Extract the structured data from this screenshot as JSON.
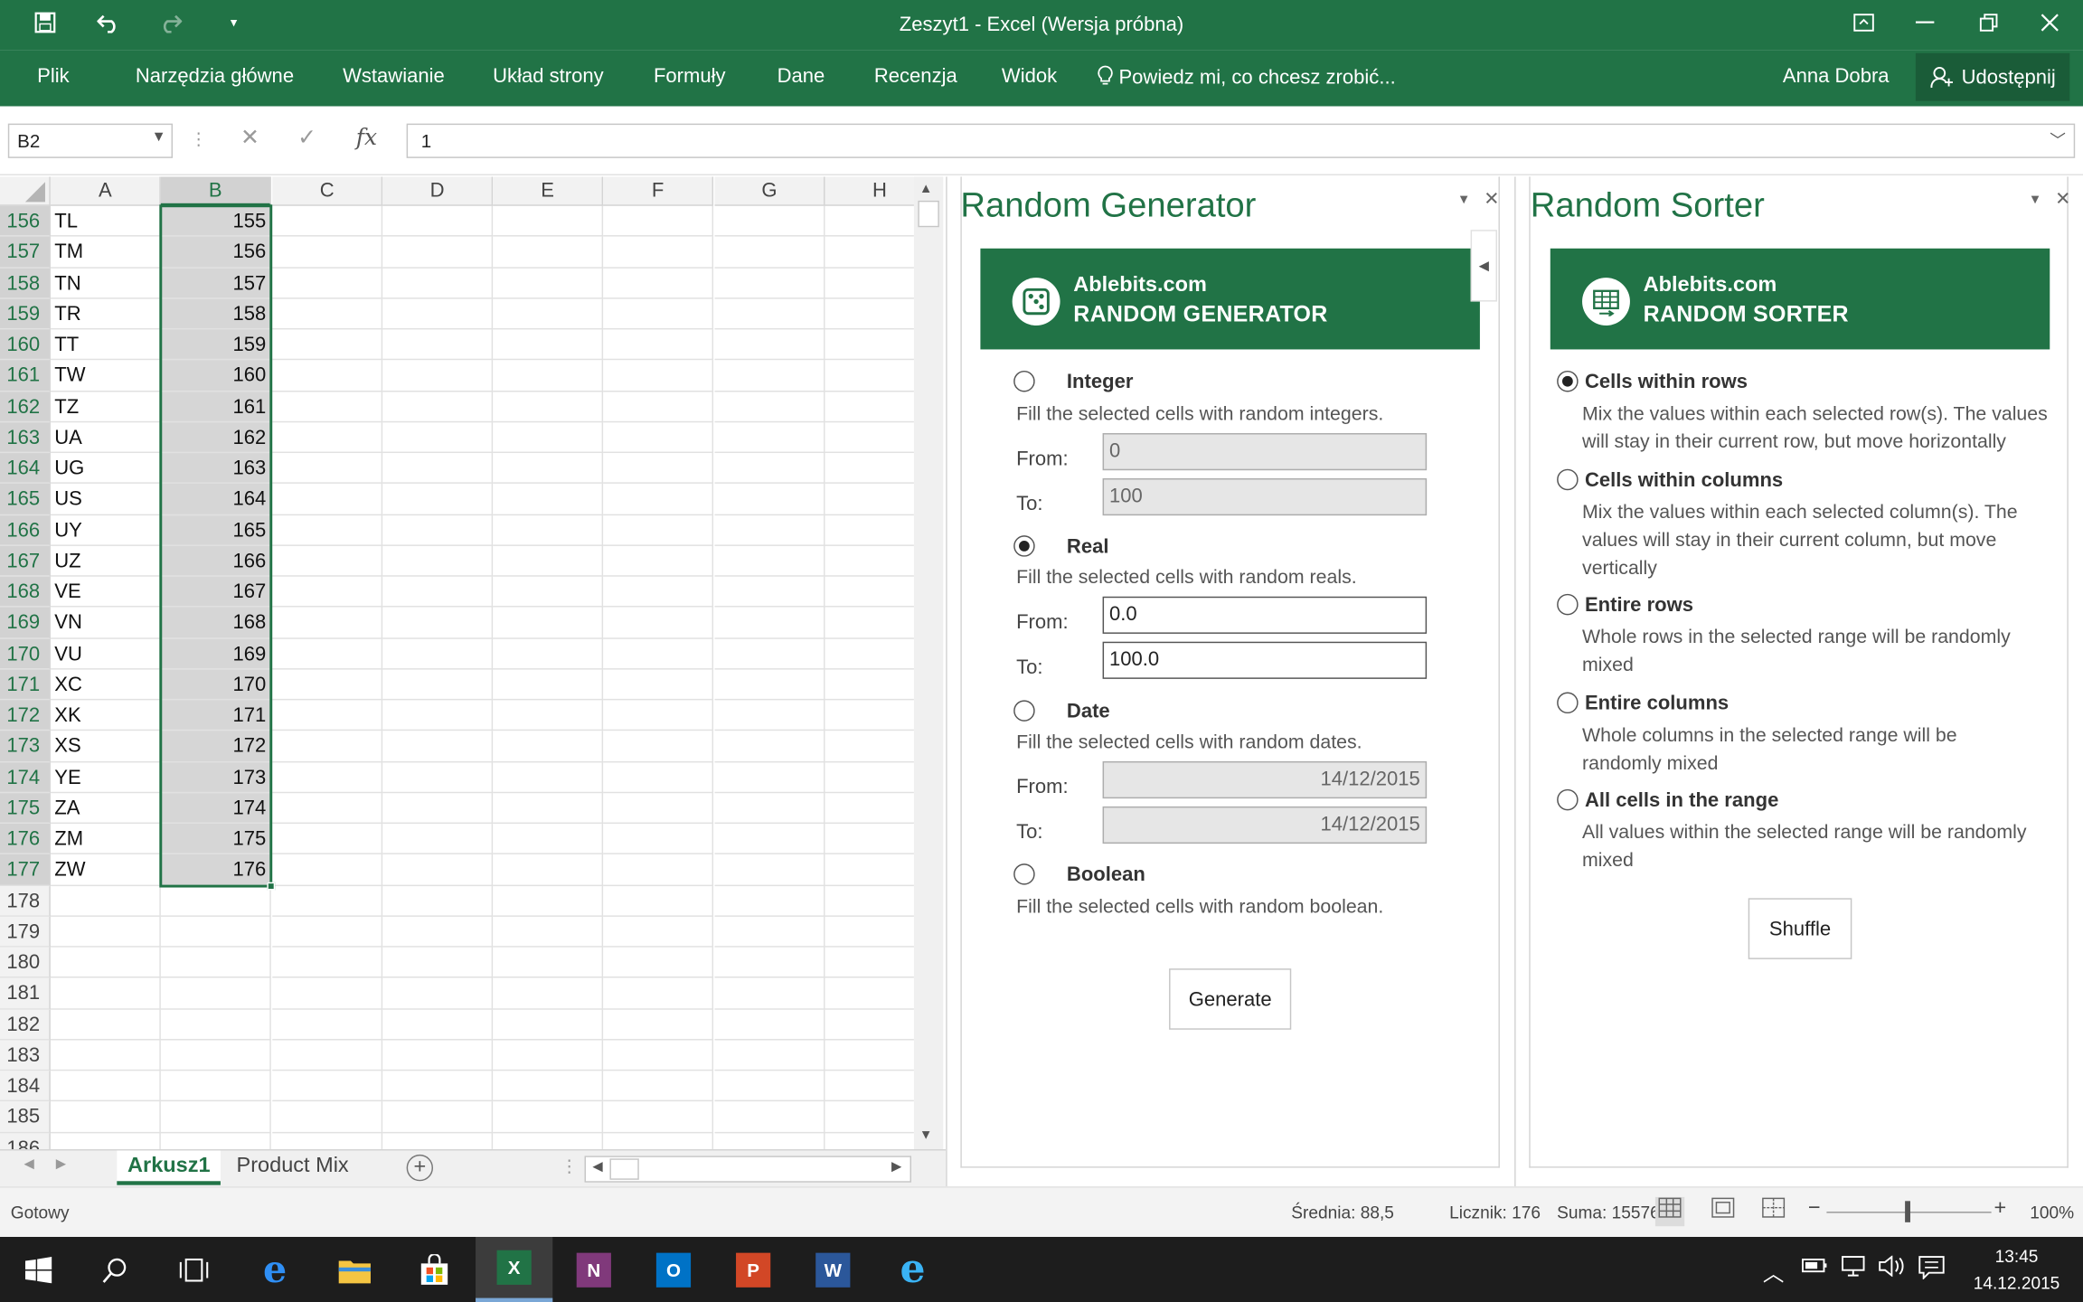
{
  "window": {
    "title": "Zeszyt1 - Excel (Wersja próbna)"
  },
  "ribbon": {
    "tabs": [
      "Plik",
      "Narzędzia główne",
      "Wstawianie",
      "Układ strony",
      "Formuły",
      "Dane",
      "Recenzja",
      "Widok"
    ],
    "tell_me": "Powiedz mi, co chcesz zrobić...",
    "user": "Anna Dobra",
    "share": "Udostępnij"
  },
  "formula_bar": {
    "name_box": "B2",
    "fx": "fx",
    "value": "1"
  },
  "grid": {
    "columns": [
      "A",
      "B",
      "C",
      "D",
      "E",
      "F",
      "G",
      "H"
    ],
    "rows": [
      {
        "num": "156",
        "a": "TL",
        "b": "155"
      },
      {
        "num": "157",
        "a": "TM",
        "b": "156"
      },
      {
        "num": "158",
        "a": "TN",
        "b": "157"
      },
      {
        "num": "159",
        "a": "TR",
        "b": "158"
      },
      {
        "num": "160",
        "a": "TT",
        "b": "159"
      },
      {
        "num": "161",
        "a": "TW",
        "b": "160"
      },
      {
        "num": "162",
        "a": "TZ",
        "b": "161"
      },
      {
        "num": "163",
        "a": "UA",
        "b": "162"
      },
      {
        "num": "164",
        "a": "UG",
        "b": "163"
      },
      {
        "num": "165",
        "a": "US",
        "b": "164"
      },
      {
        "num": "166",
        "a": "UY",
        "b": "165"
      },
      {
        "num": "167",
        "a": "UZ",
        "b": "166"
      },
      {
        "num": "168",
        "a": "VE",
        "b": "167"
      },
      {
        "num": "169",
        "a": "VN",
        "b": "168"
      },
      {
        "num": "170",
        "a": "VU",
        "b": "169"
      },
      {
        "num": "171",
        "a": "XC",
        "b": "170"
      },
      {
        "num": "172",
        "a": "XK",
        "b": "171"
      },
      {
        "num": "173",
        "a": "XS",
        "b": "172"
      },
      {
        "num": "174",
        "a": "YE",
        "b": "173"
      },
      {
        "num": "175",
        "a": "ZA",
        "b": "174"
      },
      {
        "num": "176",
        "a": "ZM",
        "b": "175"
      },
      {
        "num": "177",
        "a": "ZW",
        "b": "176"
      },
      {
        "num": "178",
        "a": "",
        "b": ""
      },
      {
        "num": "179",
        "a": "",
        "b": ""
      },
      {
        "num": "180",
        "a": "",
        "b": ""
      },
      {
        "num": "181",
        "a": "",
        "b": ""
      },
      {
        "num": "182",
        "a": "",
        "b": ""
      },
      {
        "num": "183",
        "a": "",
        "b": ""
      },
      {
        "num": "184",
        "a": "",
        "b": ""
      },
      {
        "num": "185",
        "a": "",
        "b": ""
      },
      {
        "num": "186",
        "a": "",
        "b": ""
      }
    ]
  },
  "sheets": {
    "tabs": [
      "Arkusz1",
      "Product Mix"
    ],
    "active": "Arkusz1"
  },
  "random_generator": {
    "title": "Random Generator",
    "banner_line1": "Ablebits.com",
    "banner_line2": "RANDOM GENERATOR",
    "options": [
      {
        "label": "Integer",
        "desc": "Fill the selected cells with random integers.",
        "from": "0",
        "to": "100",
        "checked": false
      },
      {
        "label": "Real",
        "desc": "Fill the selected cells with random reals.",
        "from": "0.0",
        "to": "100.0",
        "checked": true
      },
      {
        "label": "Date",
        "desc": "Fill the selected cells with random dates.",
        "from": "14/12/2015",
        "to": "14/12/2015",
        "checked": false
      },
      {
        "label": "Boolean",
        "desc": "Fill the selected cells with random boolean.",
        "checked": false
      }
    ],
    "from_label": "From:",
    "to_label": "To:",
    "button": "Generate"
  },
  "random_sorter": {
    "title": "Random Sorter",
    "banner_line1": "Ablebits.com",
    "banner_line2": "RANDOM SORTER",
    "options": [
      {
        "label": "Cells within rows",
        "desc": "Mix the values within each selected row(s). The values will stay in their current row, but move horizontally",
        "checked": true
      },
      {
        "label": "Cells within columns",
        "desc": "Mix the values within each selected column(s). The values will stay in their current column, but move vertically",
        "checked": false
      },
      {
        "label": "Entire rows",
        "desc": "Whole rows in the selected range will be randomly mixed",
        "checked": false
      },
      {
        "label": "Entire columns",
        "desc": "Whole columns in the selected range will be randomly mixed",
        "checked": false
      },
      {
        "label": "All cells in the range",
        "desc": "All values within the selected range will be randomly mixed",
        "checked": false
      }
    ],
    "button": "Shuffle"
  },
  "status_bar": {
    "ready": "Gotowy",
    "average": "Średnia: 88,5",
    "count": "Licznik: 176",
    "sum": "Suma: 15576",
    "zoom": "100%"
  },
  "taskbar": {
    "time": "13:45",
    "date": "14.12.2015"
  },
  "colors": {
    "excel_green": "#217346",
    "selection_gray": "#d6d6d6"
  }
}
